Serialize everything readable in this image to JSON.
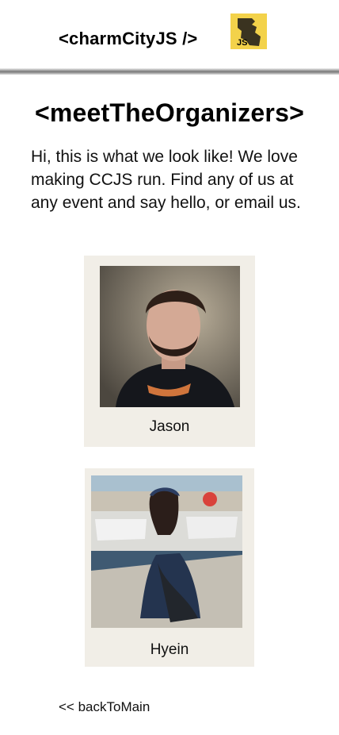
{
  "header": {
    "brand": "<charmCityJS />",
    "logo_icon": "js-logo-icon",
    "logo_text": "JS",
    "accent": "#f3d24a"
  },
  "page": {
    "title": "<meetTheOrganizers>",
    "intro": "Hi, this is what we look like! We love making CCJS run. Find any of us at any event and say hello, or email us."
  },
  "organizers": [
    {
      "name": "Jason",
      "photo_alt": "Jason"
    },
    {
      "name": "Hyein",
      "photo_alt": "Hyein"
    }
  ],
  "footer": {
    "back_link": "<< backToMain"
  },
  "colors": {
    "card_background": "#f1eee7"
  }
}
